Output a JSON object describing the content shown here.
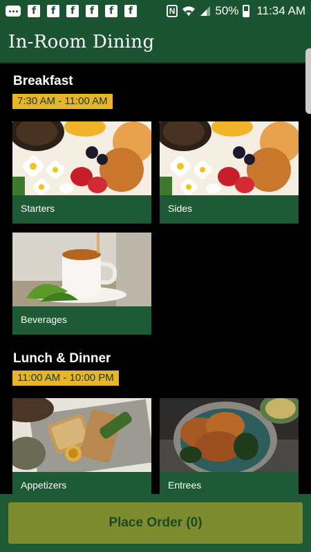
{
  "status_bar": {
    "battery": "50%",
    "time": "11:34 AM"
  },
  "header": {
    "title": "In-Room Dining"
  },
  "sections": [
    {
      "title": "Breakfast",
      "hours": "7:30 AM - 11:00 AM",
      "items": [
        {
          "label": "Starters",
          "image": "breakfast-plate-photo"
        },
        {
          "label": "Sides",
          "image": "breakfast-plate-photo"
        },
        {
          "label": "Beverages",
          "image": "tea-cup-photo"
        }
      ]
    },
    {
      "title": "Lunch & Dinner",
      "hours": "11:00 AM - 10:00 PM",
      "items": [
        {
          "label": "Appetizers",
          "image": "bruschetta-photo"
        },
        {
          "label": "Entrees",
          "image": "fried-chicken-photo"
        }
      ]
    }
  ],
  "footer": {
    "place_order_label": "Place Order (0)"
  },
  "colors": {
    "header_green": "#1a5430",
    "card_green": "#1d5a35",
    "badge_gold": "#e6b52a",
    "button_olive": "#7c8c2e"
  }
}
